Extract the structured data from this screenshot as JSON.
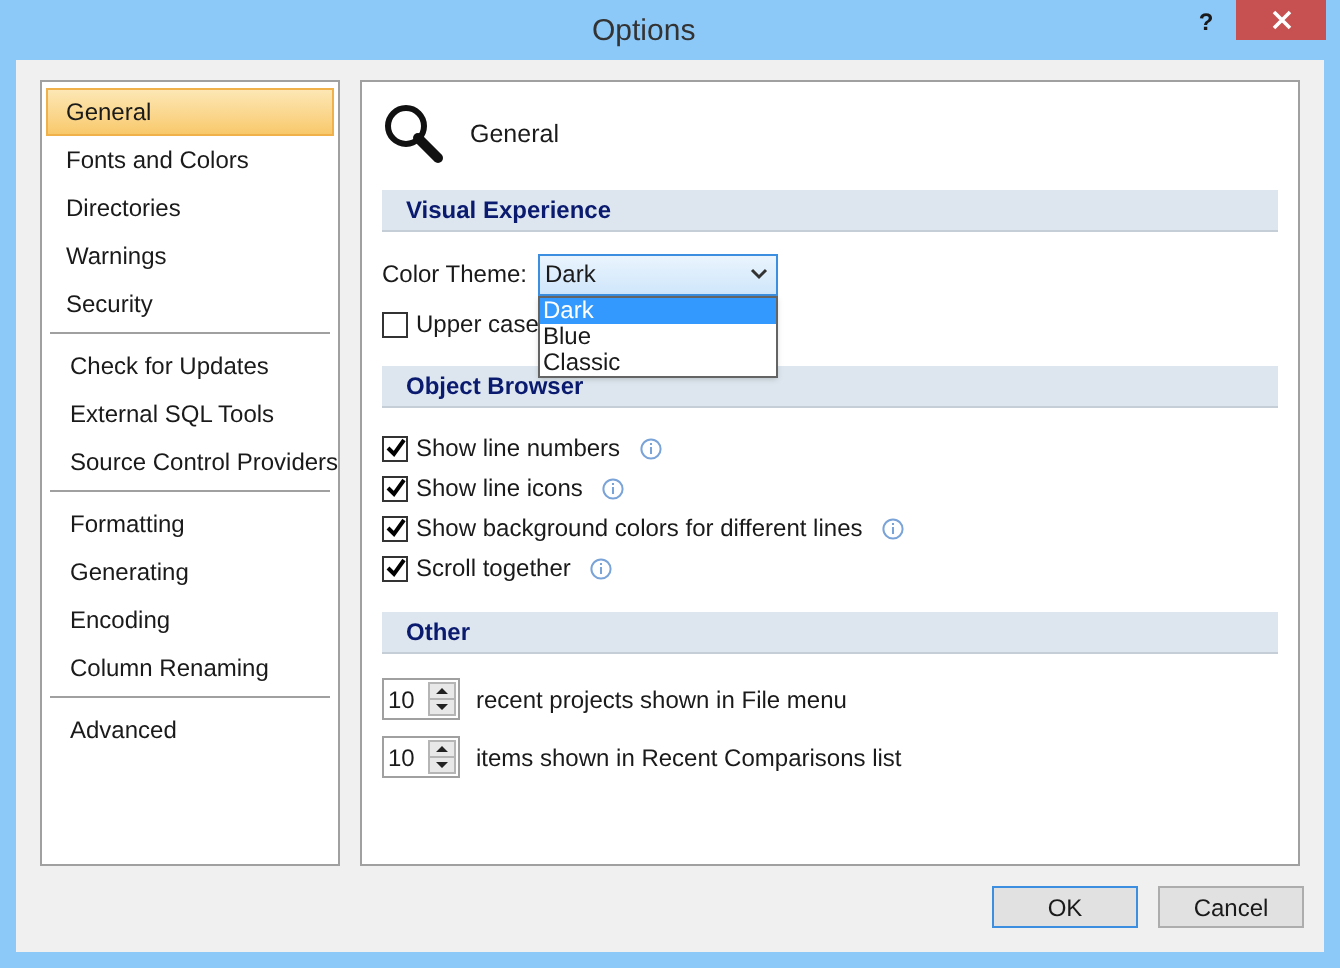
{
  "window": {
    "title": "Options",
    "help": "?"
  },
  "sidebar": {
    "groups": [
      {
        "items": [
          {
            "label": "General",
            "selected": true
          },
          {
            "label": "Fonts and Colors",
            "selected": false
          },
          {
            "label": "Directories",
            "selected": false
          },
          {
            "label": "Warnings",
            "selected": false
          },
          {
            "label": "Security",
            "selected": false
          }
        ]
      },
      {
        "items": [
          {
            "label": "Check for Updates",
            "selected": false
          },
          {
            "label": "External SQL Tools",
            "selected": false
          },
          {
            "label": "Source Control Providers",
            "selected": false
          }
        ]
      },
      {
        "items": [
          {
            "label": "Formatting",
            "selected": false
          },
          {
            "label": "Generating",
            "selected": false
          },
          {
            "label": "Encoding",
            "selected": false
          },
          {
            "label": "Column Renaming",
            "selected": false
          }
        ]
      },
      {
        "items": [
          {
            "label": "Advanced",
            "selected": false
          }
        ]
      }
    ]
  },
  "page": {
    "title": "General"
  },
  "visual_experience": {
    "header": "Visual Experience",
    "color_theme": {
      "label": "Color Theme:",
      "value": "Dark",
      "expanded": true,
      "options": [
        {
          "label": "Dark",
          "selected": true
        },
        {
          "label": "Blue",
          "selected": false
        },
        {
          "label": "Classic",
          "selected": false
        }
      ]
    },
    "upper_case": {
      "label": "Upper case",
      "checked": false
    }
  },
  "object_browser": {
    "header": "Object Browser",
    "options": [
      {
        "label": "Show line numbers",
        "checked": true
      },
      {
        "label": "Show line icons",
        "checked": true
      },
      {
        "label": "Show background colors for different lines",
        "checked": true
      },
      {
        "label": "Scroll together",
        "checked": true
      }
    ]
  },
  "other": {
    "header": "Other",
    "spinners": [
      {
        "value": "10",
        "label": "recent projects shown in File menu"
      },
      {
        "value": "10",
        "label": "items shown in Recent Comparisons list"
      }
    ]
  },
  "buttons": [
    {
      "label": "OK",
      "default": true
    },
    {
      "label": "Cancel",
      "default": false
    }
  ]
}
